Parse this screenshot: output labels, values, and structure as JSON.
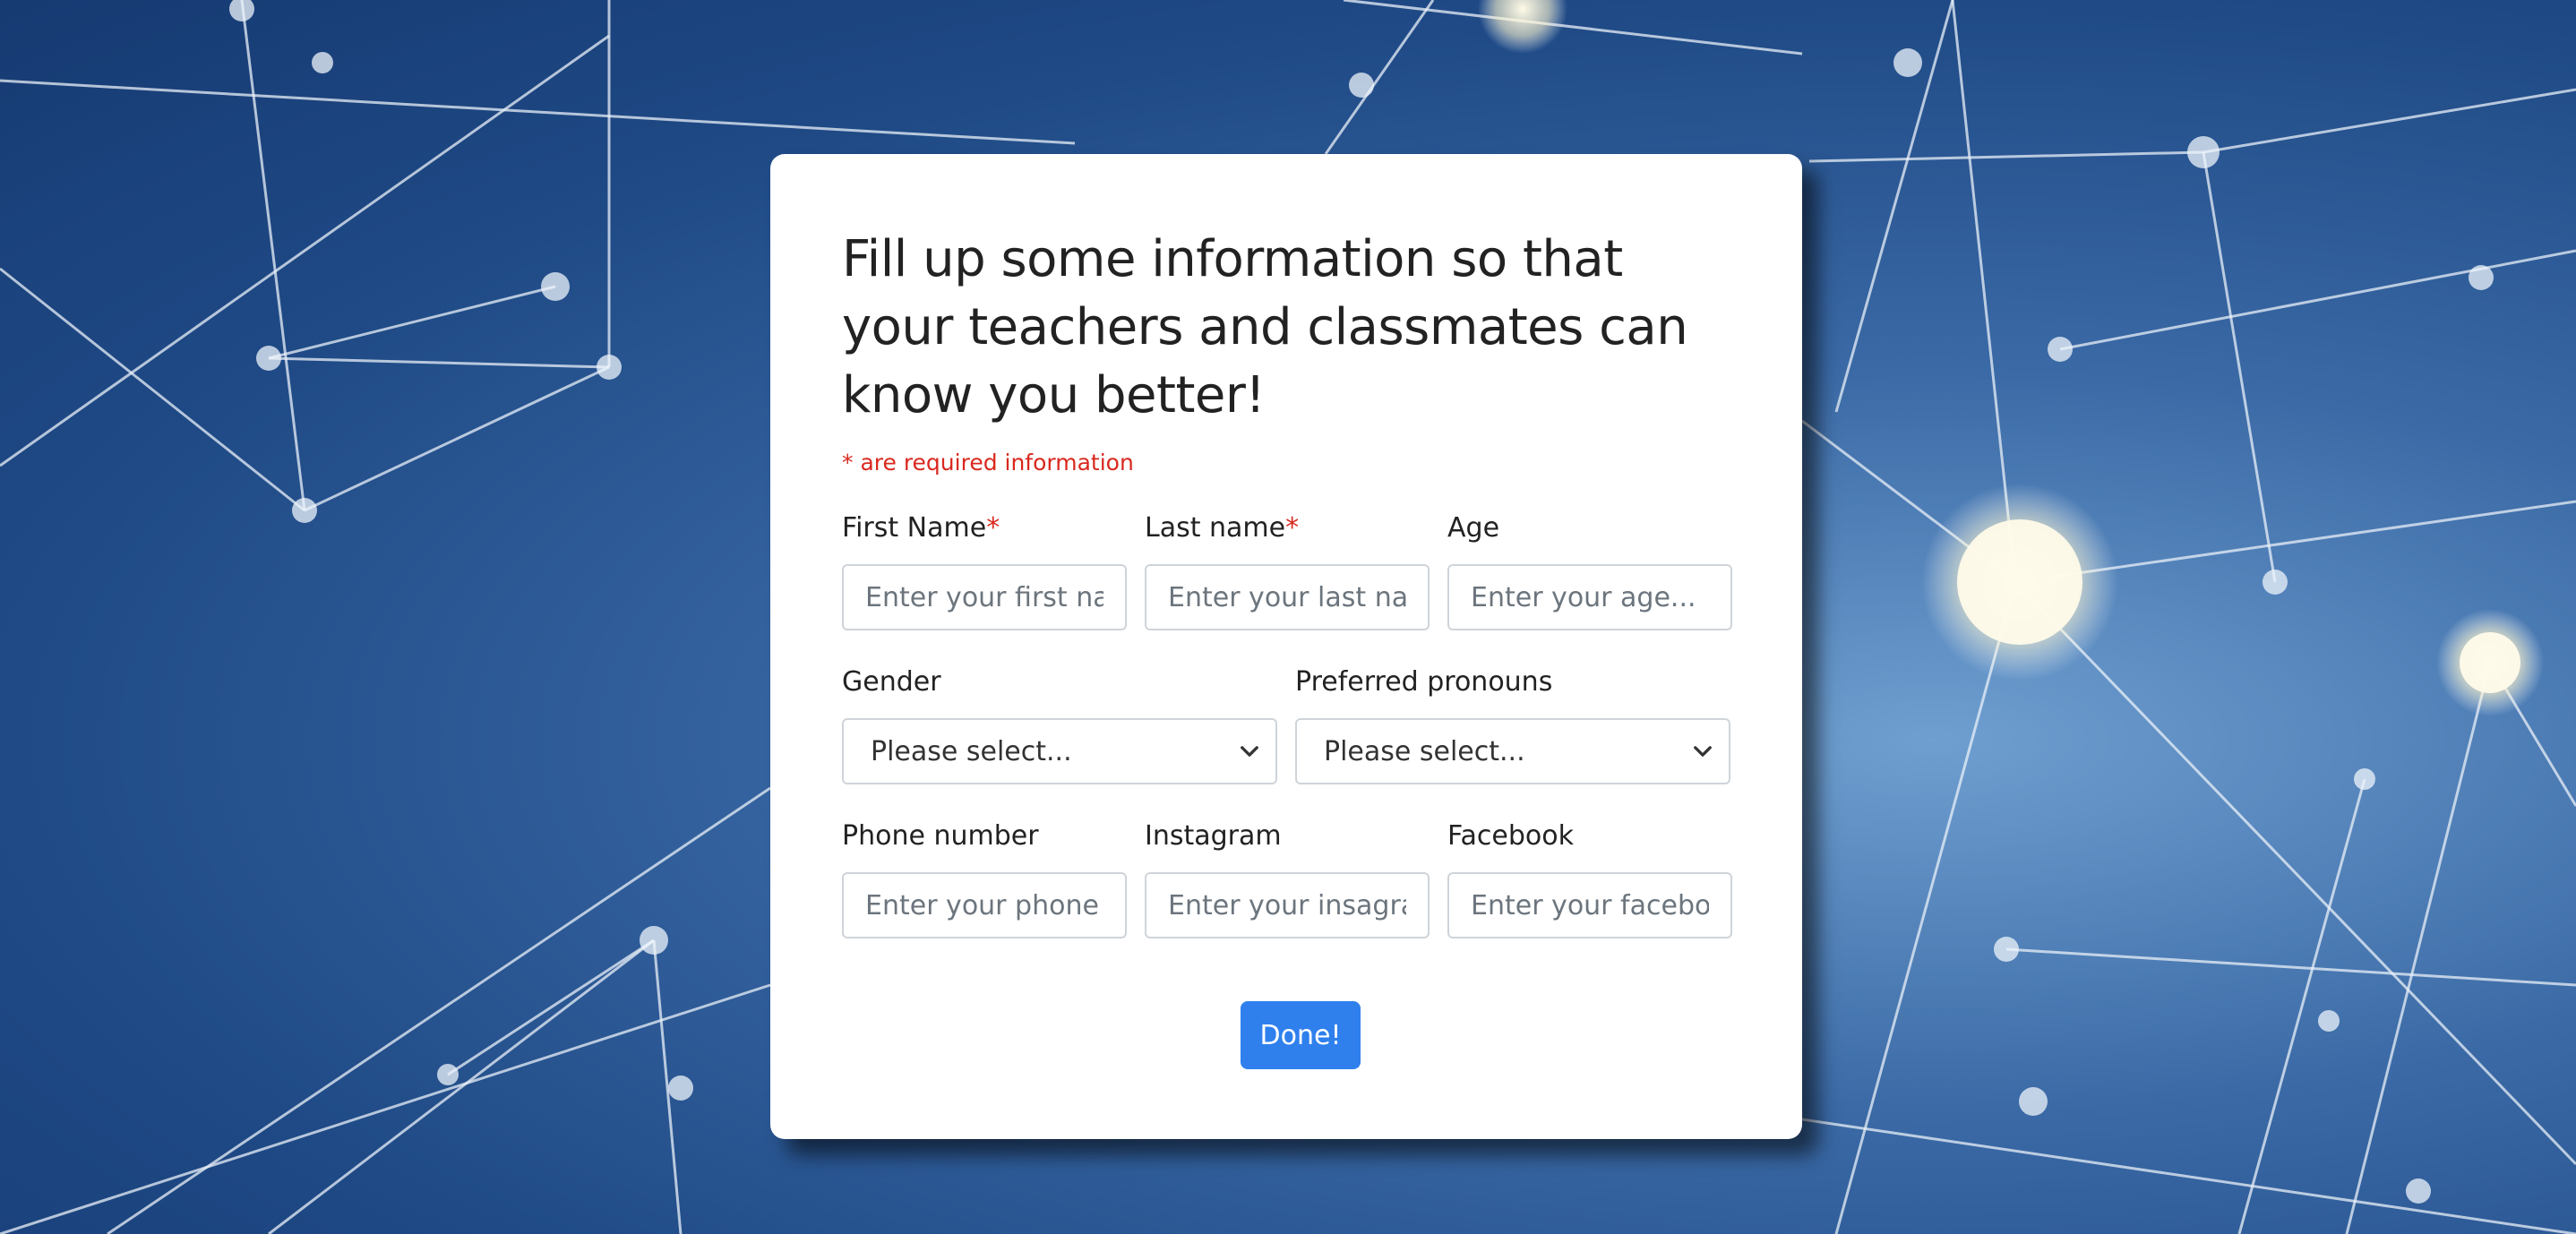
{
  "form": {
    "heading": "Fill up some information so that your teachers and classmates can know you better!",
    "required_note": "* are required information",
    "required_marker": "*",
    "fields": {
      "first_name": {
        "label": "First Name",
        "placeholder": "Enter your first name..."
      },
      "last_name": {
        "label": "Last name",
        "placeholder": "Enter your last name..."
      },
      "age": {
        "label": "Age",
        "placeholder": "Enter your age..."
      },
      "gender": {
        "label": "Gender",
        "selected": "Please select..."
      },
      "pronouns": {
        "label": "Preferred pronouns",
        "selected": "Please select..."
      },
      "phone": {
        "label": "Phone number",
        "placeholder": "Enter your phone number..."
      },
      "instagram": {
        "label": "Instagram",
        "placeholder": "Enter your insagram..."
      },
      "facebook": {
        "label": "Facebook",
        "placeholder": "Enter your facebook..."
      }
    },
    "submit_label": "Done!"
  },
  "colors": {
    "accent": "#2f80ed",
    "required": "#d9281e",
    "card_bg": "#ffffff"
  },
  "icons": {
    "select_arrow": "chevron-down-icon"
  }
}
